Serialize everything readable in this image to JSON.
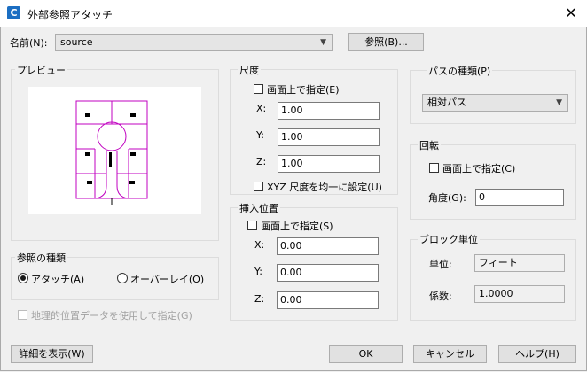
{
  "window": {
    "title": "外部参照アタッチ",
    "app_icon": "C"
  },
  "name_row": {
    "label": "名前(N):",
    "value": "source",
    "browse_button": "参照(B)..."
  },
  "preview": {
    "label": "プレビュー"
  },
  "ref_type": {
    "label": "参照の種類",
    "option_attach": "アタッチ(A)",
    "option_overlay": "オーバーレイ(O)",
    "selected": "attach"
  },
  "geo": {
    "label": "地理的位置データを使用して指定(G)"
  },
  "scale": {
    "label": "尺度",
    "on_screen": "画面上で指定(E)",
    "x_label": "X:",
    "x": "1.00",
    "y_label": "Y:",
    "y": "1.00",
    "z_label": "Z:",
    "z": "1.00",
    "uniform": "XYZ 尺度を均一に設定(U)"
  },
  "insert": {
    "label": "挿入位置",
    "on_screen": "画面上で指定(S)",
    "x_label": "X:",
    "x": "0.00",
    "y_label": "Y:",
    "y": "0.00",
    "z_label": "Z:",
    "z": "0.00"
  },
  "path": {
    "label": "パスの種類(P)",
    "value": "相対パス"
  },
  "rotation": {
    "label": "回転",
    "on_screen": "画面上で指定(C)",
    "angle_label": "角度(G):",
    "angle": "0"
  },
  "block_unit": {
    "label": "ブロック単位",
    "unit_label": "単位:",
    "unit": "フィート",
    "factor_label": "係数:",
    "factor": "1.0000"
  },
  "buttons": {
    "details": "詳細を表示(W)",
    "ok": "OK",
    "cancel": "キャンセル",
    "help": "ヘルプ(H)"
  },
  "colors": {
    "preview_line": "#c000c0",
    "accent": "#1b6ec2"
  }
}
